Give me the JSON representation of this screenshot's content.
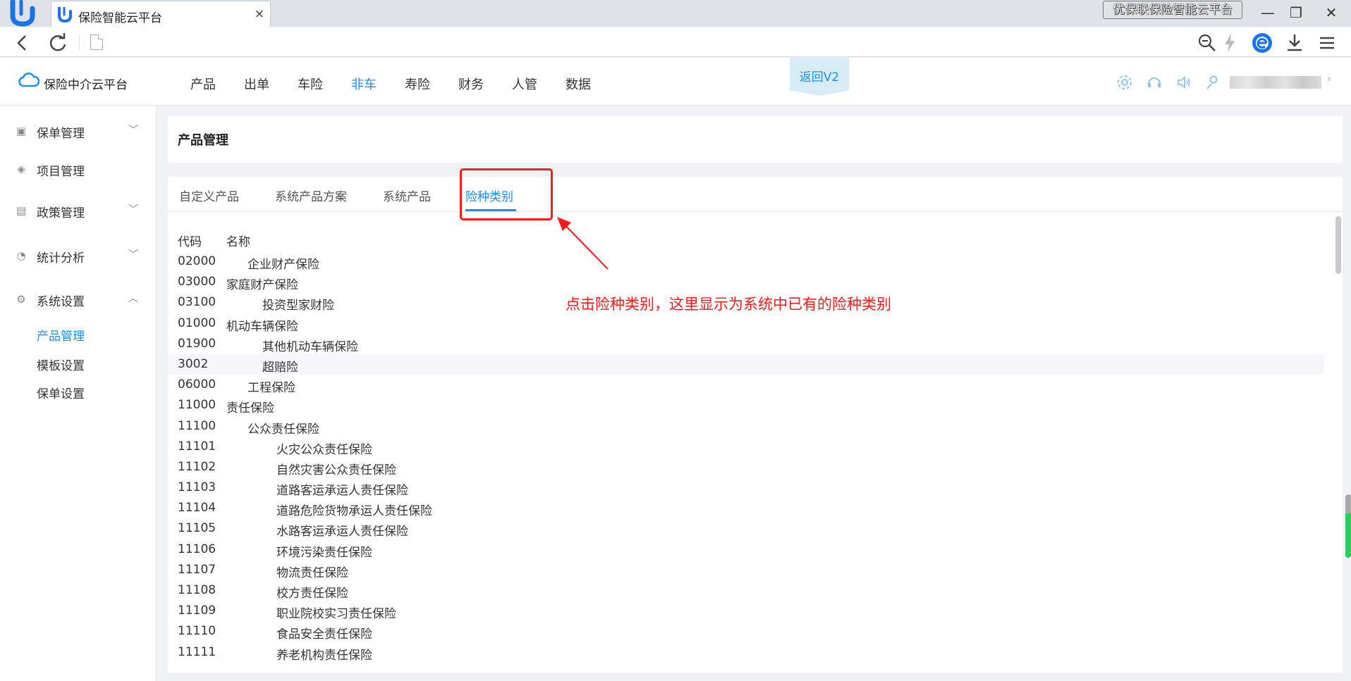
{
  "browser": {
    "tab_title": "保险智能云平台",
    "tab_close": "×",
    "title_badge": "优保联保险智能云平台",
    "win_min": "—",
    "win_max": "❐",
    "win_close": "✕"
  },
  "header": {
    "brand": "保险中介云平台",
    "nav": [
      "产品",
      "出单",
      "车险",
      "非车",
      "寿险",
      "财务",
      "人管",
      "数据"
    ],
    "active_nav": "非车",
    "back_button": "返回V2"
  },
  "sidebar": {
    "items": [
      {
        "label": "保单管理",
        "icon": "document-icon",
        "has_caret": true
      },
      {
        "label": "项目管理",
        "icon": "layers-icon",
        "has_caret": false
      },
      {
        "label": "政策管理",
        "icon": "id-card-icon",
        "has_caret": true
      },
      {
        "label": "统计分析",
        "icon": "pie-chart-icon",
        "has_caret": true
      },
      {
        "label": "系统设置",
        "icon": "gear-icon",
        "has_caret": true
      }
    ],
    "sub_items": [
      "产品管理",
      "模板设置",
      "保单设置"
    ],
    "active_sub": "产品管理"
  },
  "page": {
    "title": "产品管理",
    "tabs": [
      "自定义产品",
      "系统产品方案",
      "系统产品",
      "险种类别"
    ],
    "active_tab": "险种类别",
    "columns": {
      "code": "代码",
      "name": "名称"
    },
    "rows": [
      {
        "code": "02000",
        "name": "企业财产保险",
        "level": 1
      },
      {
        "code": "03000",
        "name": "家庭财产保险",
        "level": 0
      },
      {
        "code": "03100",
        "name": "投资型家财险",
        "level": 2
      },
      {
        "code": "01000",
        "name": "机动车辆保险",
        "level": 0
      },
      {
        "code": "01900",
        "name": "其他机动车辆保险",
        "level": 2
      },
      {
        "code": "3002",
        "name": "超赔险",
        "level": 2
      },
      {
        "code": "06000",
        "name": "工程保险",
        "level": 1
      },
      {
        "code": "11000",
        "name": "责任保险",
        "level": 0
      },
      {
        "code": "11100",
        "name": "公众责任保险",
        "level": 1
      },
      {
        "code": "11101",
        "name": "火灾公众责任保险",
        "level": 3
      },
      {
        "code": "11102",
        "name": "自然灾害公众责任保险",
        "level": 3
      },
      {
        "code": "11103",
        "name": "道路客运承运人责任保险",
        "level": 3
      },
      {
        "code": "11104",
        "name": "道路危险货物承运人责任保险",
        "level": 3
      },
      {
        "code": "11105",
        "name": "水路客运承运人责任保险",
        "level": 3
      },
      {
        "code": "11106",
        "name": "环境污染责任保险",
        "level": 3
      },
      {
        "code": "11107",
        "name": "物流责任保险",
        "level": 3
      },
      {
        "code": "11108",
        "name": "校方责任保险",
        "level": 3
      },
      {
        "code": "11109",
        "name": "职业院校实习责任保险",
        "level": 3
      },
      {
        "code": "11110",
        "name": "食品安全责任保险",
        "level": 3
      },
      {
        "code": "11111",
        "name": "养老机构责任保险",
        "level": 3
      }
    ]
  },
  "annotation": {
    "note": "点击险种类别，这里显示为系统中已有的险种类别",
    "color": "#ff1a1a"
  },
  "colors": {
    "accent": "#1890ff"
  }
}
